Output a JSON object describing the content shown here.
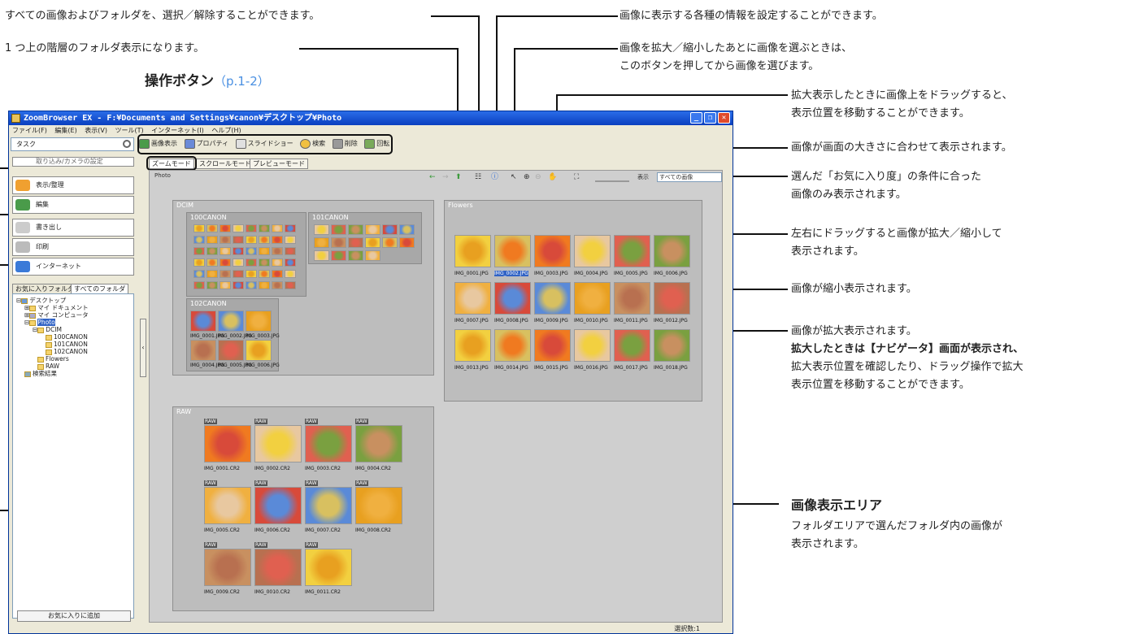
{
  "annotations": {
    "select_all": "すべての画像およびフォルダを、選択／解除することができます。",
    "parent_folder": "1 つ上の階層のフォルダ表示になります。",
    "op_buttons": "操作ボタン",
    "op_buttons_ref": "（p.1-2）",
    "info_setting": "画像に表示する各種の情報を設定することができます。",
    "select_after_zoom_1": "画像を拡大／縮小したあとに画像を選ぶときは、",
    "select_after_zoom_2": "このボタンを押してから画像を選びます。",
    "drag_move_1": "拡大表示したときに画像上をドラッグすると、",
    "drag_move_2": "表示位置を移動することができます。",
    "fit_screen": "画像が画面の大きさに合わせて表示されます。",
    "favorite_filter_1": "選んだ「お気に入り度」の条件に合った",
    "favorite_filter_2": "画像のみ表示されます。",
    "slider_1": "左右にドラッグすると画像が拡大／縮小して",
    "slider_2": "表示されます。",
    "zoom_out": "画像が縮小表示されます。",
    "zoom_in_1": "画像が拡大表示されます。",
    "zoom_in_2": "拡大したときは【ナビゲータ】画面が表示され、",
    "zoom_in_3": "拡大表示位置を確認したり、ドラッグ操作で拡大",
    "zoom_in_4": "表示位置を移動することができます。",
    "display_area": "画像表示エリア",
    "display_area_desc_1": "フォルダエリアで選んだフォルダ内の画像が",
    "display_area_desc_2": "表示されます。"
  },
  "window": {
    "title": "ZoomBrowser EX  -  F:¥Documents and Settings¥canon¥デスクトップ¥Photo",
    "menu": [
      "ファイル(F)",
      "編集(E)",
      "表示(V)",
      "ツール(T)",
      "インターネット(I)",
      "ヘルプ(H)"
    ],
    "task_label": "タスク",
    "toolbar": [
      "画像表示",
      "プロパティ",
      "スライドショー",
      "検索",
      "削除",
      "回転"
    ],
    "sidebar_buttons": [
      "取り込み/カメラの設定",
      "表示/整理",
      "編集",
      "書き出し",
      "印刷",
      "インターネット"
    ],
    "folder_tabs": [
      "お気に入りフォルダ",
      "すべてのフォルダ"
    ],
    "tree": [
      "デスクトップ",
      "マイ ドキュメント",
      "マイ コンピュータ",
      "Photo",
      "DCIM",
      "100CANON",
      "101CANON",
      "102CANON",
      "Flowers",
      "RAW",
      "検索結果"
    ],
    "add_favorite": "お気に入りに追加",
    "view_tabs": [
      "ズームモード",
      "スクロールモード",
      "プレビューモード"
    ],
    "view_title": "Photo",
    "display_label": "表示",
    "display_filter": "すべての画像",
    "folders": {
      "dcim": "DCIM",
      "c100": "100CANON",
      "c101": "101CANON",
      "c102": "102CANON",
      "flowers": "Flowers",
      "raw": "RAW"
    },
    "flowers_files": [
      "IMG_0001.JPG",
      "IMG_0002.JPG",
      "IMG_0003.JPG",
      "IMG_0004.JPG",
      "IMG_0005.JPG",
      "IMG_0006.JPG",
      "IMG_0007.JPG",
      "IMG_0008.JPG",
      "IMG_0009.JPG",
      "IMG_0010.JPG",
      "IMG_0011.JPG",
      "IMG_0012.JPG",
      "IMG_0013.JPG",
      "IMG_0014.JPG",
      "IMG_0015.JPG",
      "IMG_0016.JPG",
      "IMG_0017.JPG",
      "IMG_0018.JPG"
    ],
    "raw_files": [
      "IMG_0001.CR2",
      "IMG_0002.CR2",
      "IMG_0003.CR2",
      "IMG_0004.CR2",
      "IMG_0005.CR2",
      "IMG_0006.CR2",
      "IMG_0007.CR2",
      "IMG_0008.CR2",
      "IMG_0009.CR2",
      "IMG_0010.CR2",
      "IMG_0011.CR2"
    ],
    "c102_files": [
      "IMG_0001.JPG",
      "IMG_0002.JPG",
      "IMG_0003.JPG",
      "IMG_0004.JPG",
      "IMG_0005.JPG",
      "IMG_0006.JPG"
    ],
    "raw_badge": "RAW",
    "status": "選択数:1"
  },
  "colors": {
    "accent": "#4a90e2",
    "selected": "#3163c5",
    "title_blue": "#0a3fbf"
  }
}
